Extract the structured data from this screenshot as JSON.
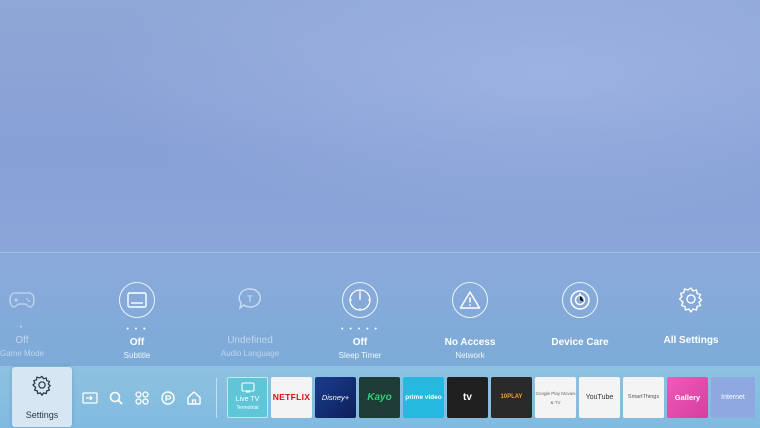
{
  "colors": {
    "background": "#8aa6d9",
    "bar": "#85bde0",
    "netflix_red": "#e50914",
    "kayo_green": "#2bd27a",
    "gallery_pink": "#e84fb3"
  },
  "quick_settings": [
    {
      "value": "Off",
      "label": "Game Mode",
      "dots": "•",
      "icon": "gamepad-icon",
      "active": false
    },
    {
      "value": "Off",
      "label": "Subtitle",
      "dots": "• • •",
      "icon": "subtitle-icon",
      "active": true
    },
    {
      "value": "Undefined",
      "label": "Audio Language",
      "dots": "",
      "icon": "audio-language-icon",
      "active": false
    },
    {
      "value": "Off",
      "label": "Sleep Timer",
      "dots": "• • • • •",
      "icon": "sleep-timer-icon",
      "active": true
    },
    {
      "value": "No Access",
      "label": "Network",
      "dots": "",
      "icon": "warning-icon",
      "active": true
    },
    {
      "value": "Device Care",
      "label": "",
      "dots": "",
      "icon": "device-care-icon",
      "active": true
    },
    {
      "value": "All Settings",
      "label": "",
      "dots": "",
      "icon": "gear-icon",
      "active": true
    }
  ],
  "bottom_bar": {
    "settings_label": "Settings",
    "nav_icons": [
      "source-icon",
      "search-icon",
      "apps-grid-icon",
      "ambient-icon",
      "home-icon"
    ],
    "apps": [
      {
        "name": "Live TV",
        "sub": "Terrestrial"
      },
      {
        "name": "NETFLIX",
        "sub": ""
      },
      {
        "name": "Disney+",
        "sub": ""
      },
      {
        "name": "Kayo",
        "sub": ""
      },
      {
        "name": "prime video",
        "sub": ""
      },
      {
        "name": "tv",
        "sub": ""
      },
      {
        "name": "10PLAY",
        "sub": ""
      },
      {
        "name": "Google Play Movies & TV",
        "sub": ""
      },
      {
        "name": "YouTube",
        "sub": ""
      },
      {
        "name": "SmartThings",
        "sub": ""
      },
      {
        "name": "Gallery",
        "sub": ""
      },
      {
        "name": "Internet",
        "sub": ""
      }
    ]
  }
}
